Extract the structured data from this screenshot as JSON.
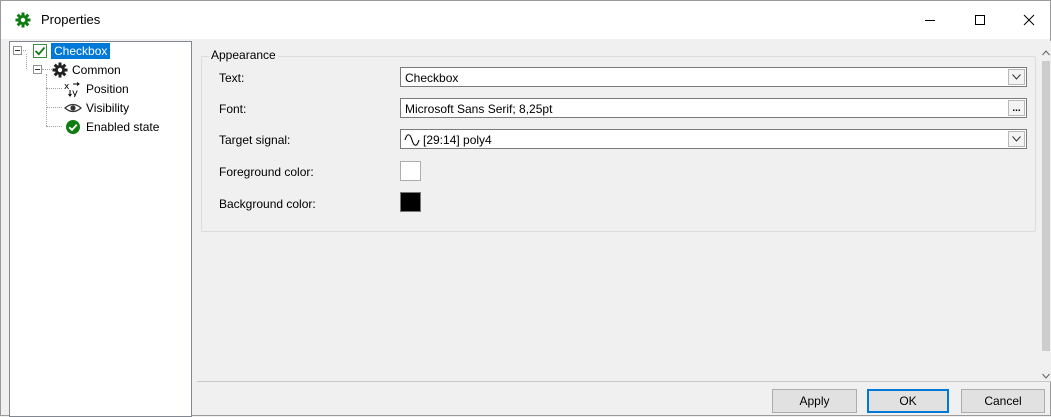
{
  "window": {
    "title": "Properties",
    "controls": {
      "minimize": "minimize",
      "maximize": "maximize",
      "close": "close"
    }
  },
  "tree": {
    "root": {
      "label": "Checkbox",
      "icon": "checkbox-icon",
      "selected": true
    },
    "group": {
      "label": "Common",
      "icon": "gear-icon"
    },
    "children": [
      {
        "label": "Position",
        "icon": "xy-position-icon"
      },
      {
        "label": "Visibility",
        "icon": "eye-icon"
      },
      {
        "label": "Enabled state",
        "icon": "check-circle-icon"
      }
    ]
  },
  "appearance": {
    "legend": "Appearance",
    "text": {
      "label": "Text:",
      "value": "Checkbox"
    },
    "font": {
      "label": "Font:",
      "value": "Microsoft Sans Serif; 8,25pt",
      "button": "..."
    },
    "target_signal": {
      "label": "Target signal:",
      "value": "[29:14] poly4",
      "icon": "signal-wave-icon"
    },
    "foreground_color": {
      "label": "Foreground color:",
      "value": "#ffffff"
    },
    "background_color": {
      "label": "Background color:",
      "value": "#000000"
    }
  },
  "buttons": {
    "apply": "Apply",
    "ok": "OK",
    "cancel": "Cancel"
  },
  "colors": {
    "selection": "#0078d7",
    "accent_green": "#107c10"
  }
}
